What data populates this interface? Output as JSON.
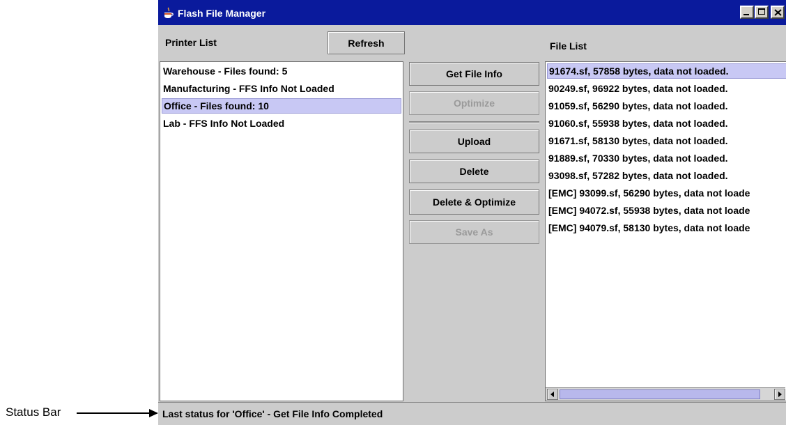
{
  "window": {
    "title": "Flash File Manager"
  },
  "printer_panel": {
    "heading": "Printer List",
    "refresh_label": "Refresh",
    "items": [
      {
        "label": "Warehouse - Files found: 5",
        "selected": false
      },
      {
        "label": "Manufacturing - FFS Info Not Loaded",
        "selected": false
      },
      {
        "label": "Office - Files found: 10",
        "selected": true
      },
      {
        "label": "Lab - FFS Info Not Loaded",
        "selected": false
      }
    ]
  },
  "actions": {
    "get_file_info": "Get File Info",
    "optimize": "Optimize",
    "upload": "Upload",
    "delete": "Delete",
    "delete_optimize": "Delete & Optimize",
    "save_as": "Save As"
  },
  "file_panel": {
    "heading": "File List",
    "items": [
      {
        "label": "91674.sf, 57858 bytes, data not loaded.",
        "selected": true
      },
      {
        "label": "90249.sf, 96922 bytes, data not loaded.",
        "selected": false
      },
      {
        "label": "91059.sf, 56290 bytes, data not loaded.",
        "selected": false
      },
      {
        "label": "91060.sf, 55938 bytes, data not loaded.",
        "selected": false
      },
      {
        "label": "91671.sf, 58130 bytes, data not loaded.",
        "selected": false
      },
      {
        "label": "91889.sf, 70330 bytes, data not loaded.",
        "selected": false
      },
      {
        "label": "93098.sf, 57282 bytes, data not loaded.",
        "selected": false
      },
      {
        "label": "[EMC] 93099.sf, 56290 bytes, data not loade",
        "selected": false
      },
      {
        "label": "[EMC] 94072.sf, 55938 bytes, data not loade",
        "selected": false
      },
      {
        "label": "[EMC] 94079.sf, 58130 bytes, data not loade",
        "selected": false
      }
    ]
  },
  "status": {
    "text": "Last status for 'Office' - Get File Info Completed"
  },
  "annotation": {
    "label": "Status Bar"
  },
  "colors": {
    "titlebar": "#0a1a9c",
    "selection": "#c8c8f4",
    "window_bg": "#cccccc"
  }
}
